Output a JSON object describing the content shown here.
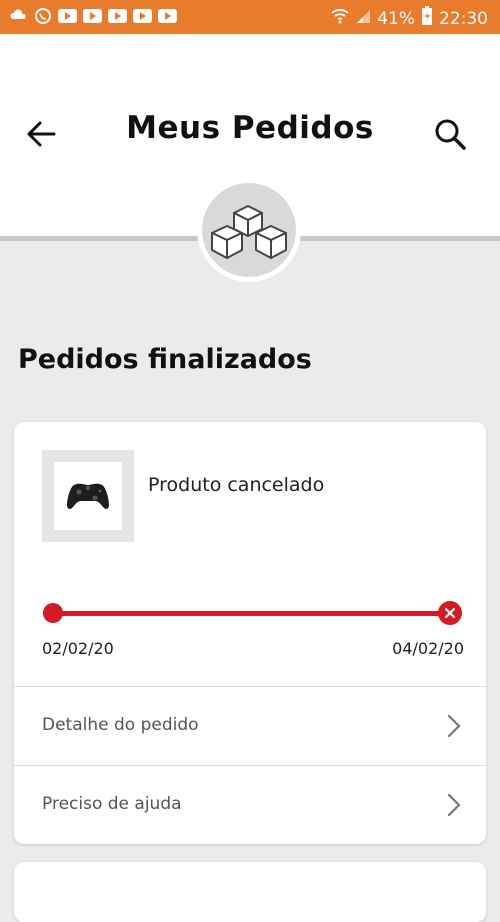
{
  "status_bar": {
    "battery": "41%",
    "time": "22:30"
  },
  "header": {
    "title": "Meus Pedidos"
  },
  "section": {
    "title": "Pedidos finalizados"
  },
  "order": {
    "status": "Produto cancelado",
    "start_date": "02/02/20",
    "end_date": "04/02/20",
    "actions": [
      {
        "label": "Detalhe do pedido"
      },
      {
        "label": "Preciso de ajuda"
      }
    ]
  },
  "colors": {
    "status_bar": "#e87c2c",
    "accent_red": "#d41b24",
    "background": "#ebebeb"
  }
}
